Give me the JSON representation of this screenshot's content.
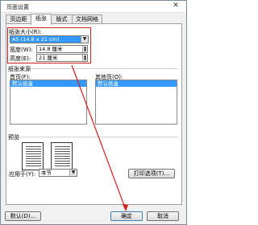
{
  "window": {
    "title": "页面设置",
    "close": "✕"
  },
  "tabs": [
    {
      "label": "页边距",
      "active": false
    },
    {
      "label": "纸张",
      "active": true
    },
    {
      "label": "版式",
      "active": false
    },
    {
      "label": "文档网格",
      "active": false
    }
  ],
  "paper_size": {
    "label": "纸张大小(R):",
    "selected": "A5 (14.8 x 21 cm)",
    "width_label": "宽度(W):",
    "width_value": "14.8 厘米",
    "height_label": "高度(E):",
    "height_value": "21 厘米"
  },
  "paper_source": {
    "label": "纸张来源",
    "first_page_label": "首页(F):",
    "first_page_item": "默认纸盒",
    "other_pages_label": "其他页(O):",
    "other_pages_item": "默认纸盒"
  },
  "preview": {
    "label": "预览"
  },
  "apply_to": {
    "label": "应用于(Y):",
    "value": "本节"
  },
  "buttons": {
    "print_options": "打印选项(T)...",
    "default": "默认(D)...",
    "ok": "确定",
    "cancel": "取消"
  },
  "colors": {
    "annotation": "#d61e1e",
    "selection": "#3399ff"
  },
  "icons": {
    "dropdown": "chevron-down-icon",
    "spin": "spin-arrows-icon",
    "close": "close-icon"
  }
}
